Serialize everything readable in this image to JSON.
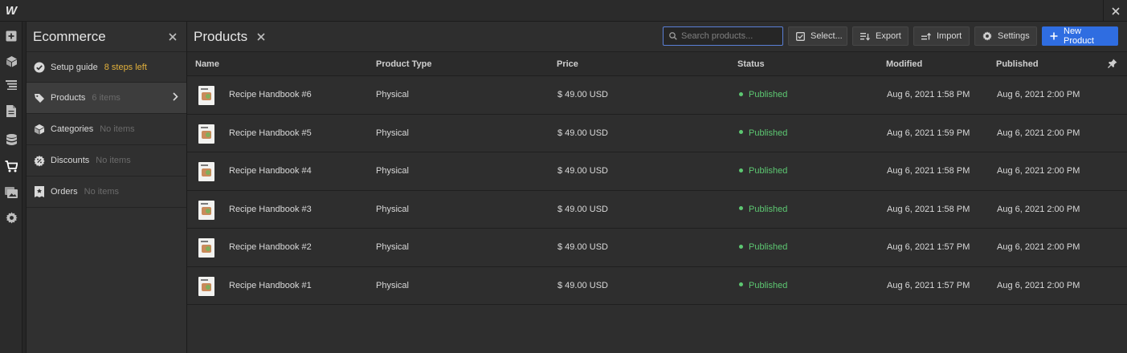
{
  "app": {
    "logo": "W"
  },
  "colors": {
    "accent": "#2f6de1",
    "published": "#5dc872",
    "warning": "#e2b13c"
  },
  "rail": [
    {
      "icon": "add-icon"
    },
    {
      "icon": "box-icon"
    },
    {
      "icon": "navigator-icon"
    },
    {
      "icon": "pages-icon"
    },
    {
      "icon": "database-icon"
    },
    {
      "icon": "cart-icon"
    },
    {
      "icon": "assets-icon"
    },
    {
      "icon": "gear-icon"
    }
  ],
  "panel": {
    "title": "Ecommerce",
    "items": [
      {
        "label": "Setup guide",
        "sub": "8 steps left"
      },
      {
        "label": "Products",
        "sub": "6 items"
      },
      {
        "label": "Categories",
        "sub": "No items"
      },
      {
        "label": "Discounts",
        "sub": "No items"
      },
      {
        "label": "Orders",
        "sub": "No items"
      }
    ]
  },
  "main": {
    "title": "Products",
    "search_placeholder": "Search products...",
    "buttons": {
      "select": "Select...",
      "export": "Export",
      "import": "Import",
      "settings": "Settings",
      "new": "New Product"
    }
  },
  "table": {
    "headers": [
      "Name",
      "Product Type",
      "Price",
      "Status",
      "Modified",
      "Published"
    ],
    "rows": [
      {
        "name": "Recipe Handbook #6",
        "type": "Physical",
        "price": "$ 49.00 USD",
        "status": "Published",
        "modified": "Aug 6, 2021 1:58 PM",
        "published": "Aug 6, 2021 2:00 PM"
      },
      {
        "name": "Recipe Handbook #5",
        "type": "Physical",
        "price": "$ 49.00 USD",
        "status": "Published",
        "modified": "Aug 6, 2021 1:59 PM",
        "published": "Aug 6, 2021 2:00 PM"
      },
      {
        "name": "Recipe Handbook #4",
        "type": "Physical",
        "price": "$ 49.00 USD",
        "status": "Published",
        "modified": "Aug 6, 2021 1:58 PM",
        "published": "Aug 6, 2021 2:00 PM"
      },
      {
        "name": "Recipe Handbook #3",
        "type": "Physical",
        "price": "$ 49.00 USD",
        "status": "Published",
        "modified": "Aug 6, 2021 1:58 PM",
        "published": "Aug 6, 2021 2:00 PM"
      },
      {
        "name": "Recipe Handbook #2",
        "type": "Physical",
        "price": "$ 49.00 USD",
        "status": "Published",
        "modified": "Aug 6, 2021 1:57 PM",
        "published": "Aug 6, 2021 2:00 PM"
      },
      {
        "name": "Recipe Handbook #1",
        "type": "Physical",
        "price": "$ 49.00 USD",
        "status": "Published",
        "modified": "Aug 6, 2021 1:57 PM",
        "published": "Aug 6, 2021 2:00 PM"
      }
    ]
  }
}
